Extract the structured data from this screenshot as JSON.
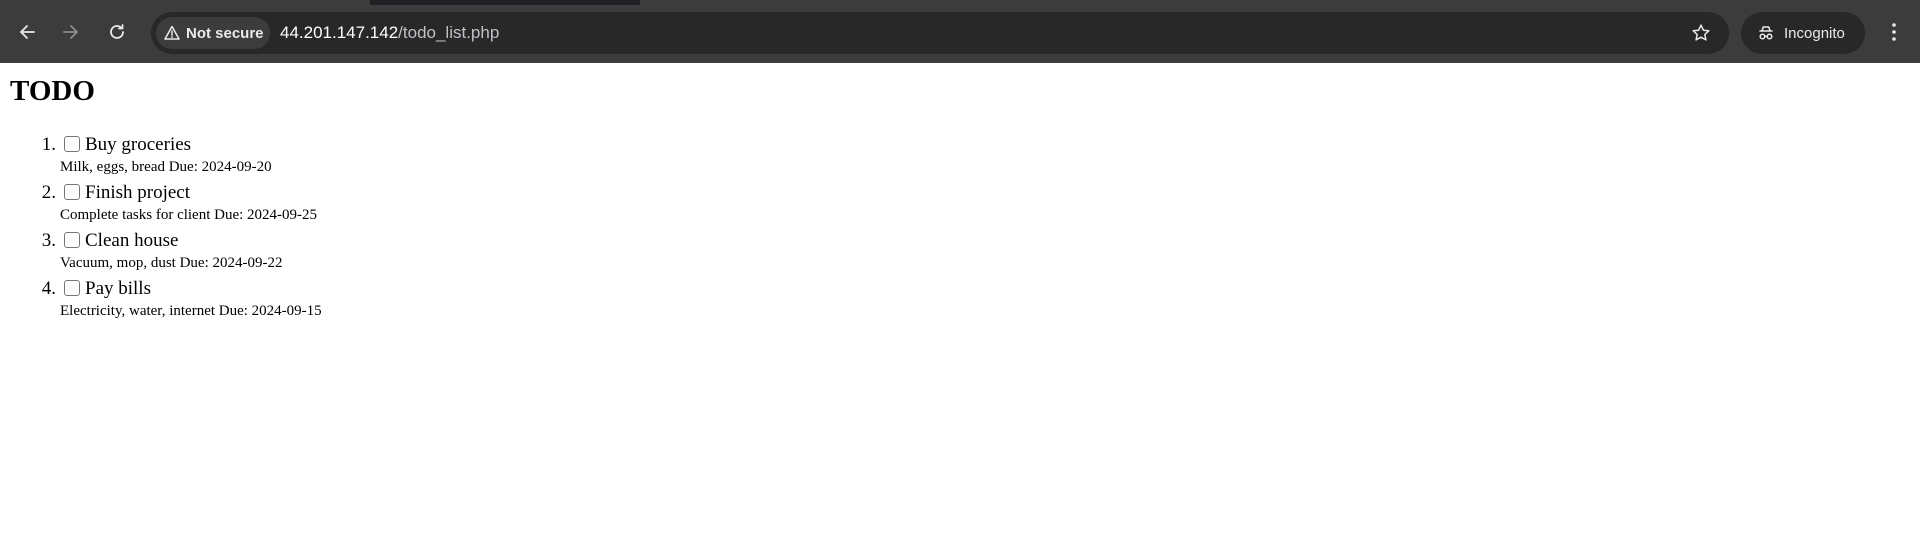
{
  "browser": {
    "security_label": "Not secure",
    "url_host": "44.201.147.142",
    "url_path": "/todo_list.php",
    "profile_label": "Incognito",
    "icons": {
      "back": "arrow-left-icon",
      "forward": "arrow-right-icon",
      "reload": "reload-icon",
      "security": "warning-triangle-icon",
      "bookmark": "star-icon",
      "incognito": "incognito-icon",
      "menu": "kebab-menu-icon"
    },
    "colors": {
      "toolbar": "#3c3c3c",
      "omnibox": "#282828",
      "text": "#e8eaed"
    }
  },
  "page": {
    "title": "TODO",
    "items": [
      {
        "number": "1.",
        "checked": false,
        "title": "Buy groceries",
        "details": "Milk, eggs, bread Due: 2024-09-20"
      },
      {
        "number": "2.",
        "checked": false,
        "title": "Finish project",
        "details": "Complete tasks for client Due: 2024-09-25"
      },
      {
        "number": "3.",
        "checked": false,
        "title": "Clean house",
        "details": "Vacuum, mop, dust Due: 2024-09-22"
      },
      {
        "number": "4.",
        "checked": false,
        "title": "Pay bills",
        "details": "Electricity, water, internet Due: 2024-09-15"
      }
    ]
  }
}
